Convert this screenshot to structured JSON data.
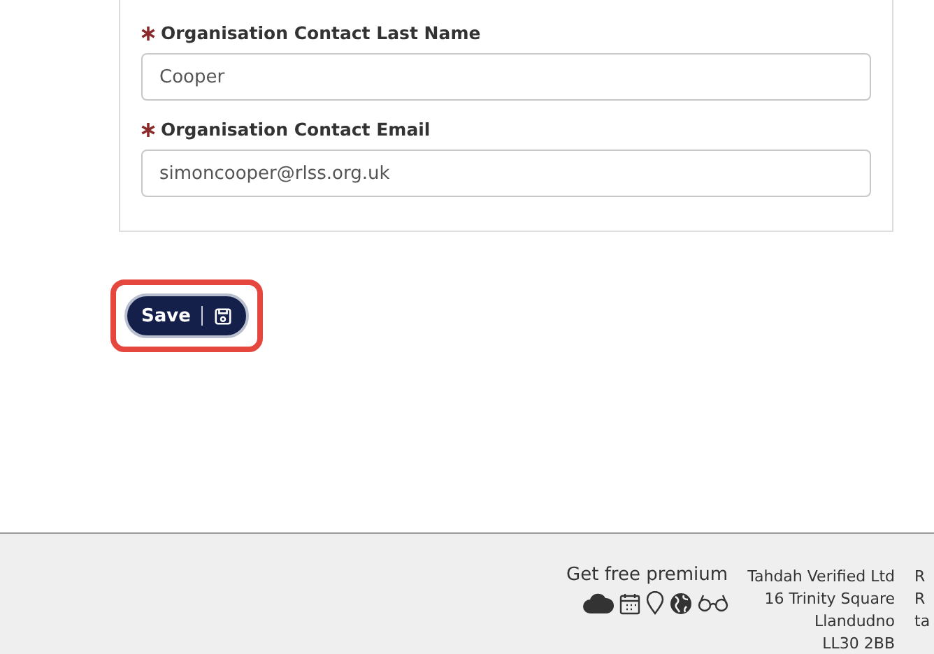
{
  "form": {
    "fields": [
      {
        "label": "Organisation Contact Last Name",
        "required": true,
        "value": "Cooper"
      },
      {
        "label": "Organisation Contact Email",
        "required": true,
        "value": "simoncooper@rlss.org.uk"
      }
    ]
  },
  "save_button": {
    "label": "Save",
    "highlighted": true
  },
  "footer": {
    "premium": {
      "title": "Get free premium"
    },
    "address": [
      "Tahdah Verified Ltd",
      "16 Trinity Square",
      "Llandudno",
      "LL30 2BB"
    ],
    "column_3": [
      "R",
      "R",
      "ta"
    ]
  }
}
